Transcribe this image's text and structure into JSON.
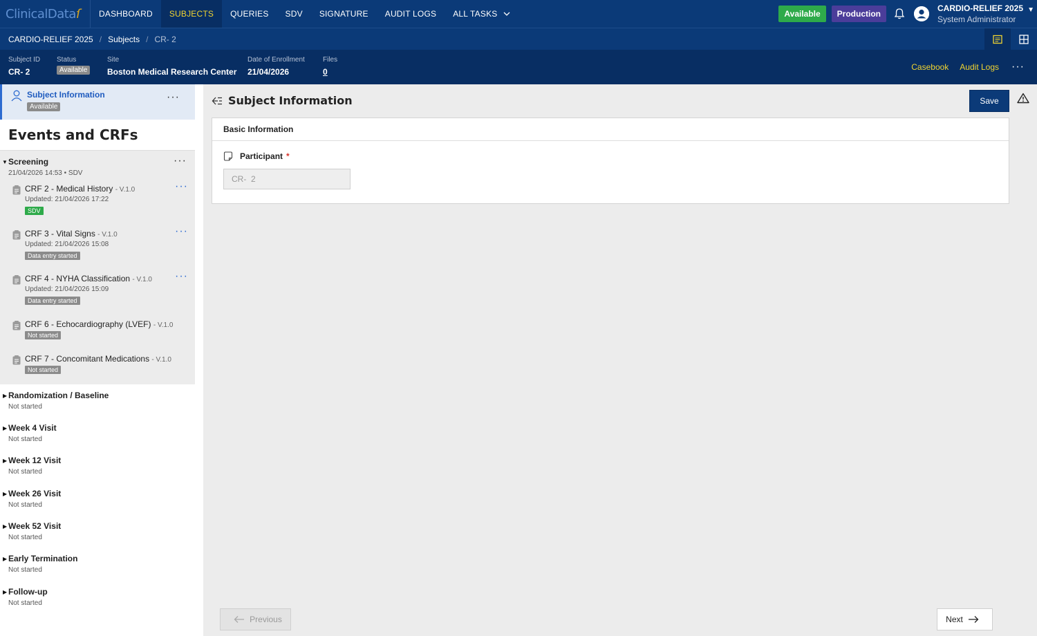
{
  "logo": {
    "text_a": "ClinicalData",
    "text_b": "ſ"
  },
  "nav": {
    "items": [
      {
        "label": "DASHBOARD"
      },
      {
        "label": "SUBJECTS"
      },
      {
        "label": "QUERIES"
      },
      {
        "label": "SDV"
      },
      {
        "label": "SIGNATURE"
      },
      {
        "label": "AUDIT LOGS"
      },
      {
        "label": "ALL TASKS"
      }
    ],
    "active": "SUBJECTS",
    "status_pill": "Available",
    "env_pill": "Production",
    "user_study": "CARDIO-RELIEF 2025",
    "user_role": "System Administrator"
  },
  "breadcrumb": [
    "CARDIO-RELIEF 2025",
    "Subjects",
    "CR- 2"
  ],
  "subject": {
    "id_label": "Subject ID",
    "id": "CR- 2",
    "status_label": "Status",
    "status": "Available",
    "site_label": "Site",
    "site": "Boston Medical Research Center",
    "enroll_label": "Date of Enrollment",
    "enroll": "21/04/2026",
    "files_label": "Files",
    "files": "0",
    "casebook": "Casebook",
    "audit_logs": "Audit Logs"
  },
  "sidebar": {
    "subject_info": "Subject Information",
    "subject_status": "Available",
    "events_title": "Events and CRFs",
    "open_event": {
      "name": "Screening",
      "sub": "21/04/2026 14:53 • SDV",
      "crfs": [
        {
          "name": "CRF 2 - Medical History",
          "ver": "- V.1.0",
          "updated": "Updated: 21/04/2026 17:22",
          "badge": "SDV",
          "badge_color": "green",
          "menu": true
        },
        {
          "name": "CRF 3 - Vital Signs",
          "ver": "- V.1.0",
          "updated": "Updated: 21/04/2026 15:08",
          "badge": "Data entry started",
          "badge_color": "gray",
          "menu": true
        },
        {
          "name": "CRF 4 - NYHA Classification",
          "ver": "- V.1.0",
          "updated": "Updated: 21/04/2026 15:09",
          "badge": "Data entry started",
          "badge_color": "gray",
          "menu": true
        },
        {
          "name": "CRF 6 - Echocardiography (LVEF)",
          "ver": "- V.1.0",
          "updated": "",
          "badge": "Not started",
          "badge_color": "gray",
          "menu": false
        },
        {
          "name": "CRF 7 - Concomitant Medications",
          "ver": "- V.1.0",
          "updated": "",
          "badge": "Not started",
          "badge_color": "gray",
          "menu": false
        }
      ]
    },
    "closed_events": [
      {
        "name": "Randomization / Baseline",
        "status": "Not started"
      },
      {
        "name": "Week 4 Visit",
        "status": "Not started"
      },
      {
        "name": "Week 12 Visit",
        "status": "Not started"
      },
      {
        "name": "Week 26 Visit",
        "status": "Not started"
      },
      {
        "name": "Week 52 Visit",
        "status": "Not started"
      },
      {
        "name": "Early Termination",
        "status": "Not started"
      },
      {
        "name": "Follow-up",
        "status": "Not started"
      }
    ]
  },
  "main": {
    "title": "Subject Information",
    "save": "Save",
    "section": "Basic Information",
    "field_label": "Participant",
    "required_mark": "*",
    "field_value": "CR-  2",
    "prev": "Previous",
    "next": "Next"
  },
  "colors": {
    "nav_bg": "#0b3a78",
    "accent_yellow": "#f1d430",
    "available_green": "#2eaa4a",
    "production_purple": "#4b3d9a",
    "link_blue": "#2d6bd0"
  }
}
